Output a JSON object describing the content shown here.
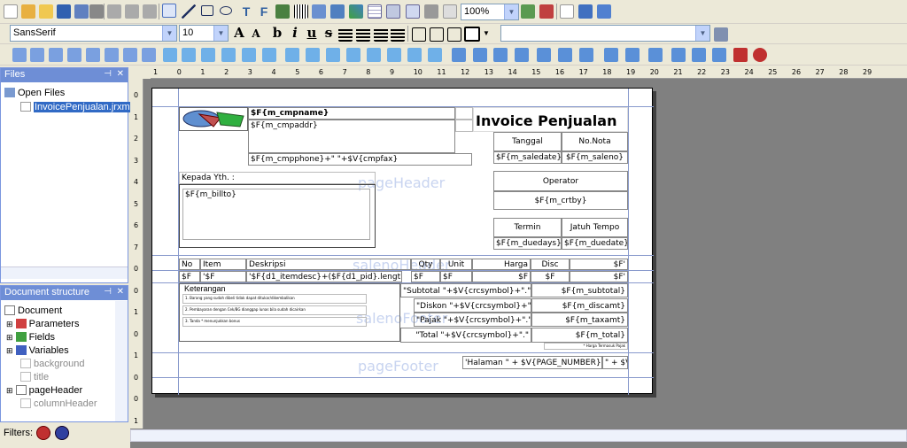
{
  "toolbar": {
    "zoom": "100%",
    "font_family": "SansSerif",
    "font_size": "10",
    "style_combo": ""
  },
  "files_panel": {
    "title": "Files",
    "open_files_label": "Open Files",
    "file_name": "InvoicePenjualan.jrxml"
  },
  "structure_panel": {
    "title": "Document structure",
    "items": [
      "Document",
      "Parameters",
      "Fields",
      "Variables",
      "background",
      "title",
      "pageHeader",
      "columnHeader"
    ]
  },
  "filters_label": "Filters:",
  "report": {
    "title": "Invoice Penjualan",
    "company_name": "$F{m_cmpname}",
    "company_addr": "$F{m_cmpaddr}",
    "company_phone": "$F{m_cmpphone}+\" \"+$V{cmpfax}",
    "lbl_tanggal": "Tanggal",
    "lbl_nonota": "No.Nota",
    "fld_saledate": "$F{m_saledate}",
    "fld_saleno": "$F{m_saleno}",
    "lbl_kepada": "Kepada Yth. :",
    "fld_billto": "$F{m_billto}",
    "lbl_operator": "Operator",
    "fld_crtby": "$F{m_crtby}",
    "lbl_termin": "Termin",
    "lbl_jatuhtempo": "Jatuh Tempo",
    "fld_duedays": "$F{m_duedays}",
    "fld_duedate": "$F{m_duedate}",
    "band_pageheader": "pageHeader",
    "band_saleno_header": "salenoHeader",
    "band_saleno_footer": "salenoFooter",
    "band_pagefooter": "pageFooter",
    "col_no": "No",
    "col_item": "Item",
    "col_deskripsi": "Deskripsi",
    "col_qty": "Qty",
    "col_unit": "Unit",
    "col_harga": "Harga",
    "col_disc": "Disc",
    "col_total": "$F'",
    "det_no": "$F",
    "det_item": "'$F",
    "det_desc": "'$F{d1_itemdesc}+($F{d1_pid}.length()",
    "det_qty": "$F",
    "det_unit": "$F",
    "det_harga": "$F",
    "det_disc": "$F",
    "det_total": "$F'",
    "lbl_keterangan": "Keterangan",
    "note1": "1. Barang yang sudah dibeli tidak dapat ditukar/dikembalikan",
    "note2": "2. Pembayaran dengan Cek/BG dianggap lunas bila sudah dicairkan",
    "note3": "3. Tanda * menunjukkan bonus",
    "sum_subtotal_lbl": "\"Subtotal \"+$V{crcsymbol}+\".\"",
    "sum_diskon_lbl": "\"Diskon \"+$V{crcsymbol}+\".\"",
    "sum_pajak_lbl": "\"Pajak \"+$V{crcsymbol}+\".\"",
    "sum_total_lbl": "\"Total \"+$V{crcsymbol}+\".\"",
    "sum_subtotal": "$F{m_subtotal}",
    "sum_diskon": "$F{m_discamt}",
    "sum_pajak": "$F{m_taxamt}",
    "sum_total": "$F{m_total}",
    "harga_note": "* Harga Termasuk Pajak",
    "page_number": "'Halaman \" + $V{PAGE_NUMBER}",
    "page_number2": "\" + $V"
  },
  "ruler_top": [
    "1",
    "0",
    "1",
    "2",
    "3",
    "4",
    "5",
    "6",
    "7",
    "8",
    "9",
    "10",
    "11",
    "12",
    "13",
    "14",
    "15",
    "16",
    "17",
    "18",
    "19",
    "20",
    "21",
    "22",
    "23",
    "24",
    "25",
    "26",
    "27",
    "28",
    "29"
  ],
  "ruler_left": [
    "0",
    "1",
    "2",
    "3",
    "4",
    "5",
    "6",
    "7",
    "0",
    "0",
    "1",
    "0",
    "1",
    "0",
    "0",
    "1"
  ]
}
